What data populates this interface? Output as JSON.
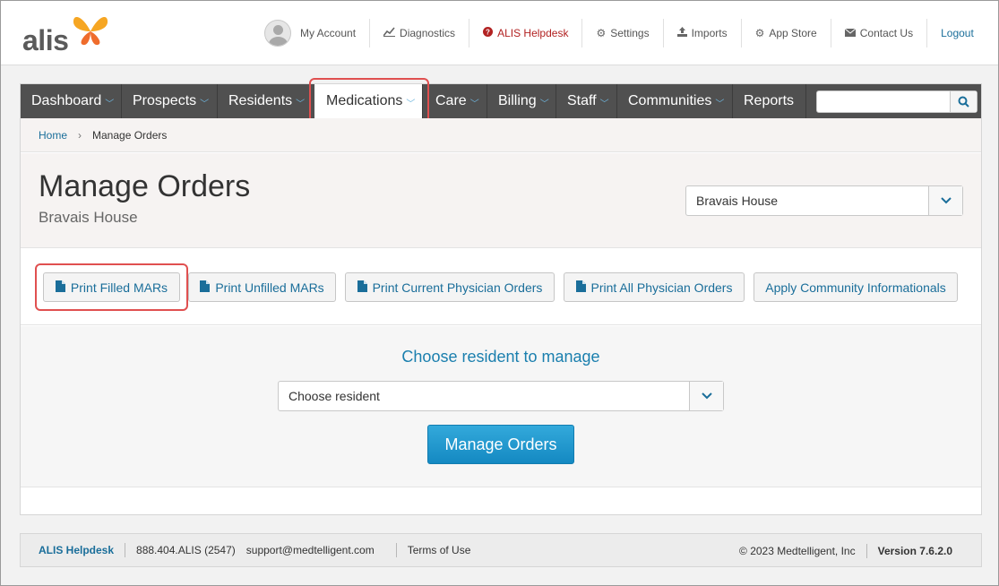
{
  "brand": {
    "logo_text": "alis"
  },
  "top_links": {
    "my_account": "My Account",
    "diagnostics": "Diagnostics",
    "helpdesk": "ALIS Helpdesk",
    "settings": "Settings",
    "imports": "Imports",
    "app_store": "App Store",
    "contact_us": "Contact Us",
    "logout": "Logout"
  },
  "nav": {
    "items": [
      {
        "label": "Dashboard"
      },
      {
        "label": "Prospects"
      },
      {
        "label": "Residents"
      },
      {
        "label": "Medications"
      },
      {
        "label": "Care"
      },
      {
        "label": "Billing"
      },
      {
        "label": "Staff"
      },
      {
        "label": "Communities"
      },
      {
        "label": "Reports"
      }
    ],
    "active": "Medications",
    "search_placeholder": ""
  },
  "breadcrumb": {
    "home": "Home",
    "current": "Manage Orders"
  },
  "header": {
    "title": "Manage Orders",
    "subtitle": "Bravais House",
    "community_value": "Bravais House"
  },
  "actions": {
    "print_filled": "Print Filled MARs",
    "print_unfilled": "Print Unfilled MARs",
    "print_current_orders": "Print Current Physician Orders",
    "print_all_orders": "Print All Physician Orders",
    "apply_informationals": "Apply Community Informationals"
  },
  "manage": {
    "choose_label": "Choose resident to manage",
    "resident_placeholder": "Choose resident",
    "button_label": "Manage Orders"
  },
  "footer": {
    "helpdesk": "ALIS Helpdesk",
    "phone": "888.404.ALIS (2547)",
    "email": "support@medtelligent.com",
    "terms": "Terms of Use",
    "copyright": "© 2023 Medtelligent, Inc",
    "version": "Version 7.6.2.0"
  },
  "colors": {
    "accent": "#1a6e9a",
    "nav_bg": "#505050",
    "highlight": "#e05050",
    "primary_button": "#1489c2"
  }
}
